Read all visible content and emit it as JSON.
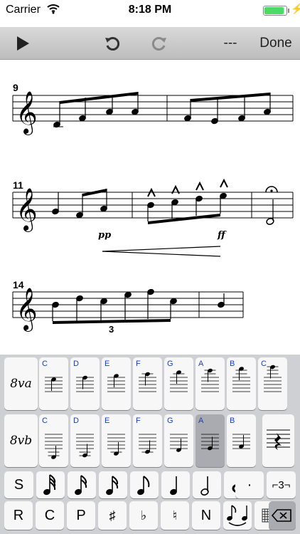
{
  "status_bar": {
    "carrier": "Carrier",
    "time": "8:18 PM",
    "battery_level": 0.9
  },
  "toolbar": {
    "play_icon": "play-icon",
    "undo_icon": "undo-icon",
    "redo_icon": "redo-icon",
    "dashes_label": "---",
    "done_label": "Done"
  },
  "score": {
    "systems": [
      {
        "measure_number": "9"
      },
      {
        "measure_number": "11",
        "dynamics": [
          "pp",
          "ff"
        ]
      },
      {
        "measure_number": "14",
        "tuplet": "3"
      }
    ]
  },
  "keyboard": {
    "octave_up_label": "8va",
    "octave_down_label": "8vb",
    "pitch_row_up": [
      "C",
      "D",
      "E",
      "F",
      "G",
      "A",
      "B",
      "C"
    ],
    "pitch_row_down": [
      "C",
      "D",
      "E",
      "F",
      "G",
      "A",
      "B"
    ],
    "selected_pitch_down": "A",
    "duration_row": {
      "s_label": "S",
      "dot_label": "·",
      "tuplet_label": "⌐3¬"
    },
    "bottom_row": {
      "r_label": "R",
      "c_label": "C",
      "p_label": "P",
      "sharp_label": "♯",
      "flat_label": "♭",
      "natural_label": "♮",
      "n_label": "N"
    }
  }
}
